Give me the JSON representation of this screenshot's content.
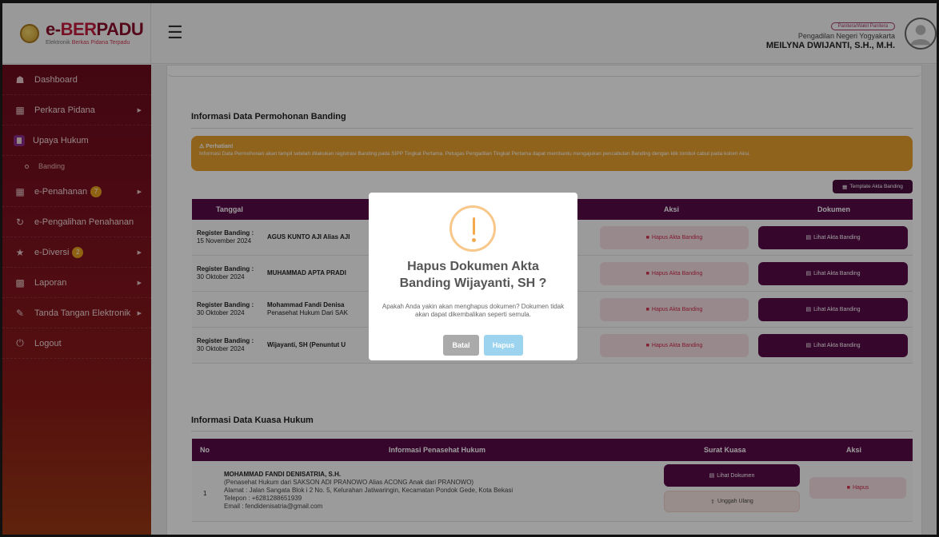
{
  "header": {
    "brand_e": "e-",
    "brand_ber": "BER",
    "brand_padu": "PADU",
    "tagline_a": "Elektronik ",
    "tagline_b": "Berkas Pidana Terpadu",
    "role": "Panitera/Wakil Panitera",
    "court": "Pengadilan Negeri Yogyakarta",
    "user_name": "MEILYNA DWIJANTI, S.H., M.H."
  },
  "sidebar": {
    "items": [
      {
        "label": "Dashboard",
        "icon": "home-icon"
      },
      {
        "label": "Perkara Pidana",
        "icon": "folder-icon"
      },
      {
        "label": "Upaya Hukum",
        "icon": "book-icon"
      },
      {
        "label": "Banding",
        "icon": "dot-icon"
      },
      {
        "label": "e-Penahanan",
        "icon": "grid-icon",
        "badge": "7"
      },
      {
        "label": "e-Pengalihan Penahanan",
        "icon": "redo-icon"
      },
      {
        "label": "e-Diversi",
        "icon": "star-icon",
        "badge": "2"
      },
      {
        "label": "Laporan",
        "icon": "chart-icon"
      },
      {
        "label": "Tanda Tangan Elektronik",
        "icon": "signature-icon"
      },
      {
        "label": "Logout",
        "icon": "power-icon"
      }
    ]
  },
  "permohonan": {
    "title": "Informasi Data Permohonan Banding",
    "alert_title": "Perhatian!",
    "alert_text": "Informasi Data Permohonan akan tampil setelah dilakukan registrasi Banding pada SIPP Tingkat Pertama. Petugas Pengadilan Tingkat Pertama dapat membantu mengajukan pencabutan Banding dengan klik tombol cabut pada kolom Aksi.",
    "template_button": "Template Akta Banding",
    "headers": [
      "Tanggal",
      "Aksi",
      "Dokumen"
    ],
    "delete_label": "Hapus Akta Banding",
    "view_label": "Lihat Akta Banding",
    "rows": [
      {
        "label": "Register Banding :",
        "date": "15 November 2024",
        "name": "AGUS KUNTO AJI Alias AJI",
        "sub": ""
      },
      {
        "label": "Register Banding :",
        "date": "30 Oktober 2024",
        "name": "MUHAMMAD APTA PRADI",
        "sub": ""
      },
      {
        "label": "Register Banding :",
        "date": "30 Oktober 2024",
        "name": "Mohammad Fandi Denisa",
        "sub": "Penasehat Hukum Dari SAK"
      },
      {
        "label": "Register Banding :",
        "date": "30 Oktober 2024",
        "name": "Wijayanti, SH (Penuntut U",
        "sub": ""
      }
    ]
  },
  "kuasa": {
    "title": "Informasi Data Kuasa Hukum",
    "headers": [
      "No",
      "Informasi Penasehat Hukum",
      "Surat Kuasa",
      "Aksi"
    ],
    "row": {
      "no": "1",
      "name": "MOHAMMAD FANDI DENISATRIA, S.H.",
      "line1": "(Penasehat Hukum dari SAKSON ADI PRANOWO Alias ACONG Anak dari PRANOWO)",
      "line2": "Alamat : Jalan Sangata Blok i 2 No. 5, Kelurahan Jatiwaringin, Kecamatan Pondok Gede, Kota Bekasi",
      "line3": "Telepon : +6281288651939",
      "line4": "Email : fendidenisatria@gmail.com",
      "view_doc": "Lihat Dokumen",
      "reupload": "Unggah Ulang",
      "delete": "Hapus"
    }
  },
  "modal": {
    "title": "Hapus Dokumen Akta Banding Wijayanti, SH ?",
    "text": "Apakah Anda yakin akan menghapus dokumen? Dokumen tidak akan dapat dikembalikan seperti semula.",
    "cancel": "Batal",
    "confirm": "Hapus"
  },
  "colors": {
    "primary": "#5a0a4a",
    "warning": "#e8a02e",
    "danger_text": "#d12b4a"
  }
}
